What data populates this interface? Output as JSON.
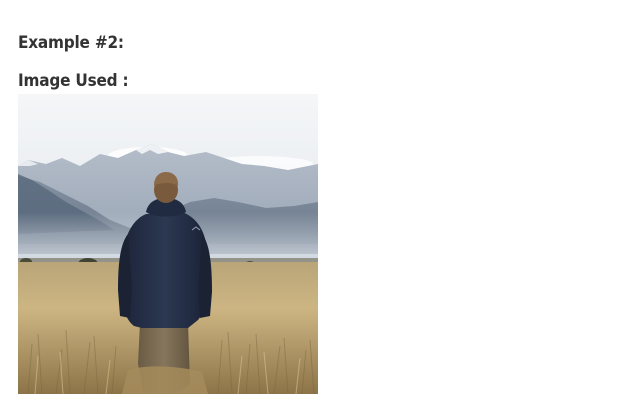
{
  "content": {
    "example_heading": "Example #2:",
    "image_label": "Image Used :"
  },
  "photo": {
    "subject": "person in dark hooded jacket standing in a golden grass field facing misty mountains",
    "colors": {
      "sky_top": "#f4f6f8",
      "sky_bottom": "#e3e7ec",
      "mountain_far": "#a7b1be",
      "mountain_near": "#6d7c8e",
      "haze": "#cfd6de",
      "field_light": "#cdb583",
      "field_dark": "#8c7448",
      "jacket": "#25304a",
      "pants": "#7a6a52",
      "hair": "#8a6a48"
    }
  }
}
